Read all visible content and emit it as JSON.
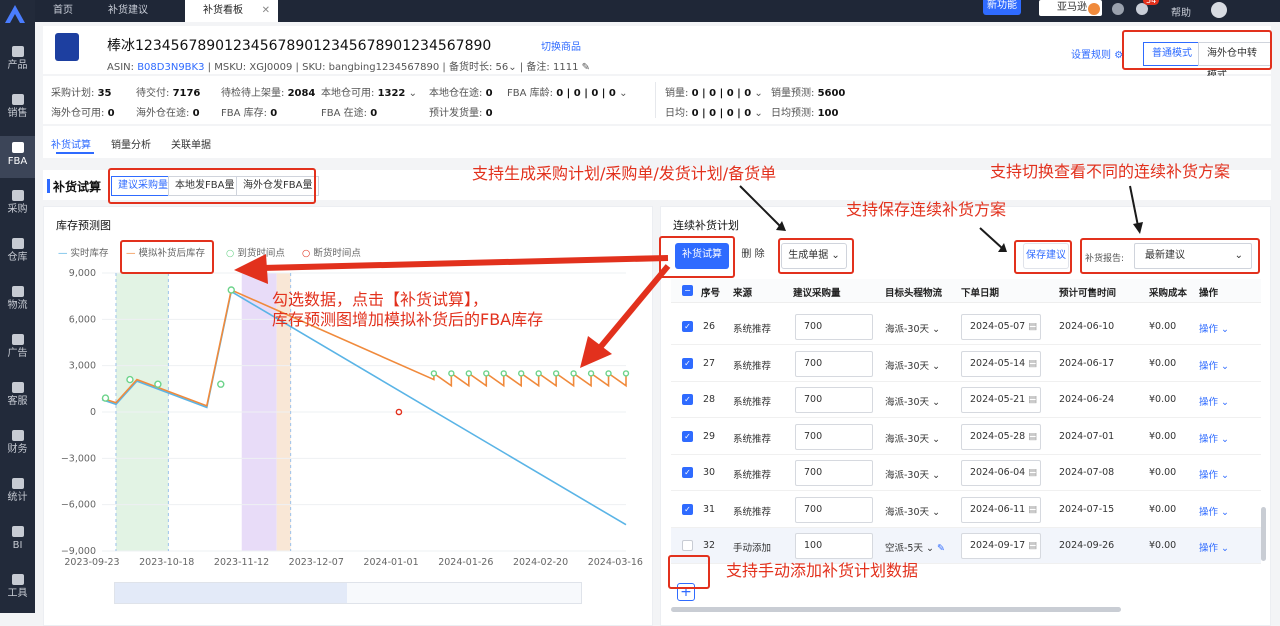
{
  "sidebar": {
    "items": [
      "产品",
      "销售",
      "FBA",
      "采购",
      "仓库",
      "物流",
      "广告",
      "客服",
      "财务",
      "统计",
      "BI",
      "工具"
    ],
    "active": "FBA"
  },
  "topbar": {
    "tabs": [
      {
        "label": "首页"
      },
      {
        "label": "补货建议"
      },
      {
        "label": "补货看板"
      }
    ],
    "new_feature": "新功能",
    "shop": "亚马逊",
    "help": "帮助",
    "badge": "54"
  },
  "product": {
    "title": "棒冰1234567890123456789012345678901234567890",
    "switch_label": "切换商品",
    "asin_label": "ASIN:",
    "asin": "B08D3N9BK3",
    "msku_label": "MSKU:",
    "msku": "XGJ0009",
    "sku_label": "SKU:",
    "sku": "bangbing1234567890",
    "stock_time_label": "备货时长:",
    "stock_time": "56",
    "note_label": "备注:",
    "note": "1111",
    "rules": "设置规则",
    "mode_normal": "普通模式",
    "mode_overseas": "海外仓中转模式"
  },
  "stats": {
    "purchase_plan": {
      "label": "采购计划:",
      "value": "35"
    },
    "to_deliver": {
      "label": "待交付:",
      "value": "7176"
    },
    "to_inspect": {
      "label": "待检待上架量:",
      "value": "2084"
    },
    "local_avail": {
      "label": "本地仓可用:",
      "value": "1322"
    },
    "local_transit": {
      "label": "本地仓在途:",
      "value": "0"
    },
    "fba_age": {
      "label": "FBA 库龄:",
      "value": "0 | 0 | 0 | 0"
    },
    "sales": {
      "label": "销量:",
      "value": "0 | 0 | 0 | 0"
    },
    "sales_forecast": {
      "label": "销量预测:",
      "value": "5600"
    },
    "overseas_avail": {
      "label": "海外仓可用:",
      "value": "0"
    },
    "overseas_transit": {
      "label": "海外仓在途:",
      "value": "0"
    },
    "fba_stock": {
      "label": "FBA 库存:",
      "value": "0"
    },
    "fba_transit": {
      "label": "FBA 在途:",
      "value": "0"
    },
    "planned_ship": {
      "label": "预计发货量:",
      "value": "0"
    },
    "daily_avg": {
      "label": "日均:",
      "value": "0 | 0 | 0 | 0"
    },
    "daily_forecast": {
      "label": "日均预测:",
      "value": "100"
    }
  },
  "tabs": [
    "补货试算",
    "销量分析",
    "关联单据"
  ],
  "trial": {
    "title": "补货试算",
    "seg": [
      "建议采购量",
      "本地发FBA量",
      "海外仓发FBA量"
    ]
  },
  "chart_title": "库存预测图",
  "legend": [
    "实时库存",
    "模拟补货后库存",
    "到货时间点",
    "断货时间点"
  ],
  "plan": {
    "title": "连续补货计划",
    "btn_trial": "补货试算",
    "btn_delete": "删 除",
    "btn_generate": "生成单据",
    "btn_save": "保存建议",
    "report_label": "补货报告:",
    "report_value": "最新建议",
    "headers": [
      "序号",
      "来源",
      "建议采购量",
      "目标头程物流",
      "下单日期",
      "预计可售时间",
      "采购成本",
      "操作"
    ],
    "rows": [
      {
        "no": "26",
        "source": "系统推荐",
        "qty": "700",
        "logistics": "海派-30天",
        "order": "2024-05-07",
        "sale": "2024-06-10",
        "cost": "¥0.00",
        "op": "操作",
        "checked": true
      },
      {
        "no": "27",
        "source": "系统推荐",
        "qty": "700",
        "logistics": "海派-30天",
        "order": "2024-05-14",
        "sale": "2024-06-17",
        "cost": "¥0.00",
        "op": "操作",
        "checked": true
      },
      {
        "no": "28",
        "source": "系统推荐",
        "qty": "700",
        "logistics": "海派-30天",
        "order": "2024-05-21",
        "sale": "2024-06-24",
        "cost": "¥0.00",
        "op": "操作",
        "checked": true
      },
      {
        "no": "29",
        "source": "系统推荐",
        "qty": "700",
        "logistics": "海派-30天",
        "order": "2024-05-28",
        "sale": "2024-07-01",
        "cost": "¥0.00",
        "op": "操作",
        "checked": true
      },
      {
        "no": "30",
        "source": "系统推荐",
        "qty": "700",
        "logistics": "海派-30天",
        "order": "2024-06-04",
        "sale": "2024-07-08",
        "cost": "¥0.00",
        "op": "操作",
        "checked": true
      },
      {
        "no": "31",
        "source": "系统推荐",
        "qty": "700",
        "logistics": "海派-30天",
        "order": "2024-06-11",
        "sale": "2024-07-15",
        "cost": "¥0.00",
        "op": "操作",
        "checked": true
      },
      {
        "no": "32",
        "source": "手动添加",
        "qty": "100",
        "logistics": "空派-5天",
        "order": "2024-09-17",
        "sale": "2024-09-26",
        "cost": "¥0.00",
        "op": "操作",
        "checked": false
      }
    ]
  },
  "annotations": {
    "generate": "支持生成采购计划/采购单/发货计划/备货单",
    "switch": "支持切换查看不同的连续补货方案",
    "save": "支持保存连续补货方案",
    "chart1": "勾选数据，点击【补货试算】，",
    "chart2": "库存预测图增加模拟补货后的FBA库存",
    "add": "支持手动添加补货计划数据"
  },
  "chart_data": {
    "type": "line",
    "title": "库存预测图",
    "x_ticks": [
      "2023-09-23",
      "2023-10-18",
      "2023-11-12",
      "2023-12-07",
      "2024-01-01",
      "2024-01-26",
      "2024-02-20",
      "2024-03-16"
    ],
    "y_ticks": [
      "9,000",
      "6,000",
      "3,000",
      "0",
      "−3,000",
      "−6,000",
      "−9,000"
    ],
    "ylim": [
      -9000,
      9000
    ],
    "series": [
      {
        "name": "实时库存",
        "color": "#5ab4e6",
        "points": [
          [
            0,
            800
          ],
          [
            4,
            500
          ],
          [
            10,
            2000
          ],
          [
            30,
            300
          ],
          [
            37,
            7800
          ],
          [
            150,
            -7300
          ]
        ]
      },
      {
        "name": "模拟补货后库存",
        "color": "#f08a3c",
        "points": [
          [
            0,
            900
          ],
          [
            4,
            600
          ],
          [
            10,
            2100
          ],
          [
            30,
            400
          ],
          [
            37,
            7900
          ],
          [
            95,
            2100
          ]
        ]
      }
    ],
    "sawtooth_start": 95,
    "sawtooth_end": 150,
    "sawtooth_high": 2500,
    "sawtooth_low": 1700
  }
}
